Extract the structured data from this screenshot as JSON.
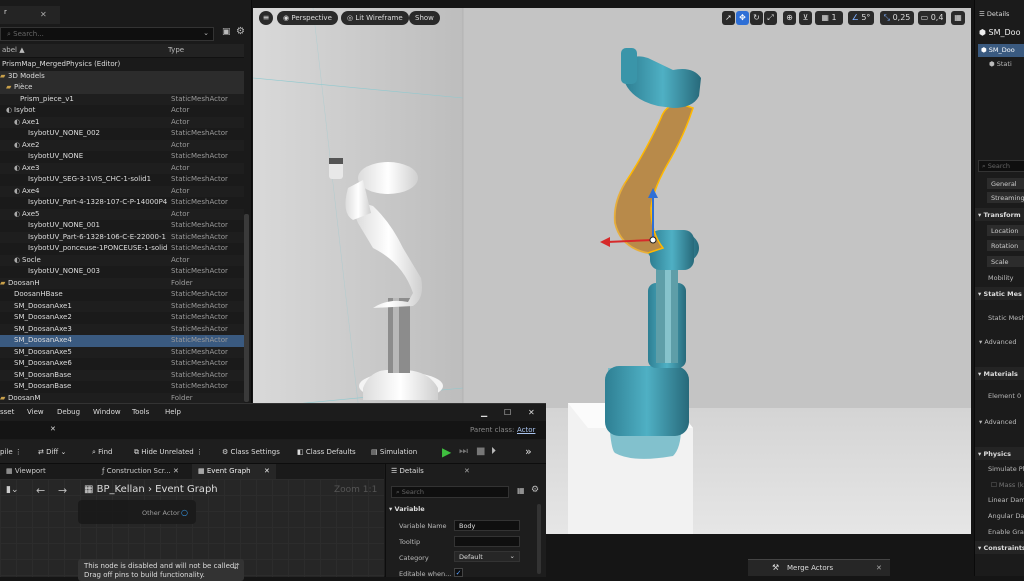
{
  "outliner": {
    "tab_label": "r",
    "search_placeholder": "Search...",
    "columns": {
      "label": "abel ▲",
      "type": "Type"
    },
    "rows": [
      {
        "label": "PrismMap_MergedPhysics (Editor)",
        "type": "",
        "indent": 2,
        "kind": "root"
      },
      {
        "label": "3D Models",
        "type": "",
        "indent": 8,
        "kind": "group"
      },
      {
        "label": "Pièce",
        "type": "",
        "indent": 14,
        "kind": "group"
      },
      {
        "label": "Prism_piece_v1",
        "type": "StaticMeshActor",
        "indent": 20,
        "kind": "mesh"
      },
      {
        "label": "Isybot",
        "type": "Actor",
        "indent": 14,
        "kind": "actor"
      },
      {
        "label": "Axe1",
        "type": "Actor",
        "indent": 22,
        "kind": "actor"
      },
      {
        "label": "IsybotUV_NONE_002",
        "type": "StaticMeshActor",
        "indent": 28,
        "kind": "mesh"
      },
      {
        "label": "Axe2",
        "type": "Actor",
        "indent": 22,
        "kind": "actor"
      },
      {
        "label": "IsybotUV_NONE",
        "type": "StaticMeshActor",
        "indent": 28,
        "kind": "mesh"
      },
      {
        "label": "Axe3",
        "type": "Actor",
        "indent": 22,
        "kind": "actor"
      },
      {
        "label": "IsybotUV_SEG-3-1VIS_CHC-1-solid1",
        "type": "StaticMeshActor",
        "indent": 28,
        "kind": "mesh"
      },
      {
        "label": "Axe4",
        "type": "Actor",
        "indent": 22,
        "kind": "actor"
      },
      {
        "label": "IsybotUV_Part-4-1328-107-C-P-14000P4",
        "type": "StaticMeshActor",
        "indent": 28,
        "kind": "mesh"
      },
      {
        "label": "Axe5",
        "type": "Actor",
        "indent": 22,
        "kind": "actor"
      },
      {
        "label": "IsybotUV_NONE_001",
        "type": "StaticMeshActor",
        "indent": 28,
        "kind": "mesh"
      },
      {
        "label": "IsybotUV_Part-6-1328-106-C-E-22000-1",
        "type": "StaticMeshActor",
        "indent": 28,
        "kind": "mesh"
      },
      {
        "label": "IsybotUV_ponceuse-1PONCEUSE-1-solid",
        "type": "StaticMeshActor",
        "indent": 28,
        "kind": "mesh"
      },
      {
        "label": "Socle",
        "type": "Actor",
        "indent": 22,
        "kind": "actor"
      },
      {
        "label": "IsybotUV_NONE_003",
        "type": "StaticMeshActor",
        "indent": 28,
        "kind": "mesh"
      },
      {
        "label": "DoosanH",
        "type": "Folder",
        "indent": 8,
        "kind": "folder"
      },
      {
        "label": "DoosanHBase",
        "type": "StaticMeshActor",
        "indent": 14,
        "kind": "mesh"
      },
      {
        "label": "SM_DoosanAxe1",
        "type": "StaticMeshActor",
        "indent": 14,
        "kind": "mesh"
      },
      {
        "label": "SM_DoosanAxe2",
        "type": "StaticMeshActor",
        "indent": 14,
        "kind": "mesh"
      },
      {
        "label": "SM_DoosanAxe3",
        "type": "StaticMeshActor",
        "indent": 14,
        "kind": "mesh"
      },
      {
        "label": "SM_DoosanAxe4",
        "type": "StaticMeshActor",
        "indent": 14,
        "kind": "mesh",
        "selected": true
      },
      {
        "label": "SM_DoosanAxe5",
        "type": "StaticMeshActor",
        "indent": 14,
        "kind": "mesh"
      },
      {
        "label": "SM_DoosanAxe6",
        "type": "StaticMeshActor",
        "indent": 14,
        "kind": "mesh"
      },
      {
        "label": "SM_DoosanBase",
        "type": "StaticMeshActor",
        "indent": 14,
        "kind": "mesh"
      },
      {
        "label": "SM_DoosanBase",
        "type": "StaticMeshActor",
        "indent": 14,
        "kind": "mesh"
      },
      {
        "label": "DoosanM",
        "type": "Folder",
        "indent": 8,
        "kind": "folder"
      }
    ]
  },
  "viewport": {
    "perspective": "Perspective",
    "view_mode": "Lit Wireframe",
    "show": "Show",
    "grid_value": "1",
    "angle_value": "5°",
    "scale_value": "0,25",
    "camera_value": "0,4",
    "accent": "#2e6fd6"
  },
  "details": {
    "title": "Details",
    "actor": "SM_Doo",
    "component_sel": "SM_Doo",
    "component_sub": "Stati",
    "search_placeholder": "Search",
    "btn_general": "General",
    "btn_streaming": "Streaming",
    "sec_transform": "Transform",
    "location": "Location",
    "rotation": "Rotation",
    "scale": "Scale",
    "mobility": "Mobility",
    "sec_static_mesh": "Static Mes",
    "static_mesh": "Static Mesh",
    "advanced1": "Advanced",
    "sec_materials": "Materials",
    "element0": "Element 0",
    "advanced2": "Advanced",
    "sec_physics": "Physics",
    "simulate_physics": "Simulate Phy",
    "mass": "Mass (k",
    "linear_damping": "Linear Damp",
    "angular_damping": "Angular Dam",
    "enable_gravity": "Enable Gravi",
    "sec_constraints": "Constraints"
  },
  "blueprint": {
    "menu": [
      "sset",
      "View",
      "Debug",
      "Window",
      "Tools",
      "Help"
    ],
    "parent_class_label": "Parent class:",
    "parent_class_value": "Actor",
    "toolbar": {
      "compile": "pile",
      "diff": "Diff",
      "find": "Find",
      "hide_unrelated": "Hide Unrelated",
      "class_settings": "Class Settings",
      "class_defaults": "Class Defaults",
      "simulation": "Simulation"
    },
    "tabs": [
      "Viewport",
      "Construction Scr...",
      "Event Graph"
    ],
    "breadcrumb_bp": "BP_Kellan",
    "breadcrumb_graph": "Event Graph",
    "zoom": "Zoom 1:1",
    "node_pin": "Other Actor",
    "disabled_line1": "This node is disabled and will not be called.",
    "disabled_line2": "Drag off pins to build functionality.",
    "details_title": "Details",
    "details_search": "Search",
    "section_variable": "Variable",
    "variable_name_label": "Variable Name",
    "variable_name_value": "Body",
    "tooltip_label": "Tooltip",
    "category_label": "Category",
    "category_value": "Default",
    "editable_label": "Editable when..."
  },
  "merge": {
    "label": "Merge Actors"
  }
}
